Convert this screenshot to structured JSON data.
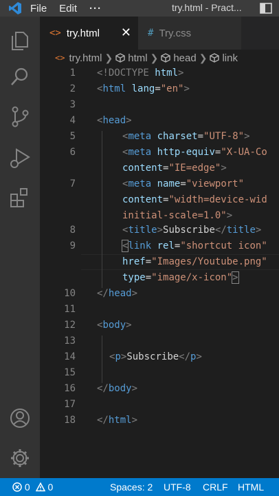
{
  "menu": {
    "file": "File",
    "edit": "Edit",
    "more": "···"
  },
  "window_title": "try.html - Pract...",
  "tabs": [
    {
      "icon": "<>",
      "label": "try.html",
      "close": "✕"
    },
    {
      "icon": "#",
      "label": "Try.css"
    }
  ],
  "breadcrumb": [
    "try.html",
    "html",
    "head",
    "link"
  ],
  "line_numbers": [
    "1",
    "2",
    "3",
    "4",
    "5",
    "6",
    "7",
    "8",
    "9",
    "10",
    "11",
    "12",
    "13",
    "14",
    "15",
    "16",
    "17",
    "18"
  ],
  "code": {
    "l1_doctype": "<!DOCTYPE",
    "l1_html": "html",
    "l1_close": ">",
    "l2_open": "<",
    "l2_tag": "html",
    "l2_attr": "lang",
    "l2_eq": "=",
    "l2_val": "\"en\"",
    "l2_close": ">",
    "l4_tag": "head",
    "meta": "meta",
    "charset": "charset",
    "charset_val": "\"UTF-8\"",
    "http_equiv": "http-equiv",
    "http_equiv_val": "\"X-UA-Co",
    "content": "content",
    "ie_edge_val": "\"IE=edge\"",
    "name": "name",
    "viewport_val": "\"viewport\"",
    "viewport_content_val": "\"width=device-wid",
    "initial_scale_val": "initial-scale=1.0\"",
    "title_tag": "title",
    "title_text": "Subscribe",
    "link_tag": "link",
    "rel": "rel",
    "rel_val": "\"shortcut icon\"",
    "href": "href",
    "href_val": "\"Images/Youtube.png\"",
    "type": "type",
    "type_val": "\"image/x-icon\"",
    "head_close": "head",
    "body_tag": "body",
    "p_tag": "p",
    "p_text": "Subscribe",
    "html_close": "html"
  },
  "status": {
    "errors": "0",
    "warnings": "0",
    "spaces": "Spaces: 2",
    "encoding": "UTF-8",
    "eol": "CRLF",
    "language": "HTML"
  }
}
